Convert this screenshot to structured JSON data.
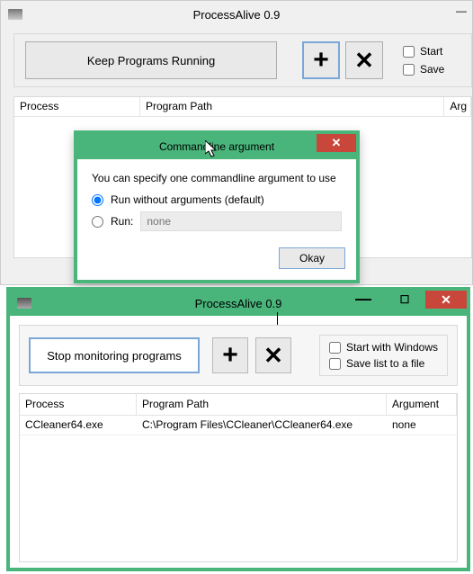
{
  "app_title": "ProcessAlive 0.9",
  "window1": {
    "keep_button": "Keep Programs Running",
    "checkbox_start": "Start",
    "checkbox_save": "Save",
    "th_process": "Process",
    "th_path": "Program Path",
    "th_arg": "Arg"
  },
  "dialog": {
    "title": "Commandline argument",
    "description": "You can specify one commandline argument to use",
    "radio_noargs": "Run without arguments (default)",
    "radio_run": "Run:",
    "run_placeholder": "none",
    "okay": "Okay"
  },
  "window2": {
    "stop_button": "Stop monitoring programs",
    "checkbox_start": "Start with Windows",
    "checkbox_save": "Save list to a file",
    "th_process": "Process",
    "th_path": "Program Path",
    "th_arg": "Argument",
    "rows": [
      {
        "process": "CCleaner64.exe",
        "path": "C:\\Program Files\\CCleaner\\CCleaner64.exe",
        "argument": "none"
      }
    ]
  }
}
